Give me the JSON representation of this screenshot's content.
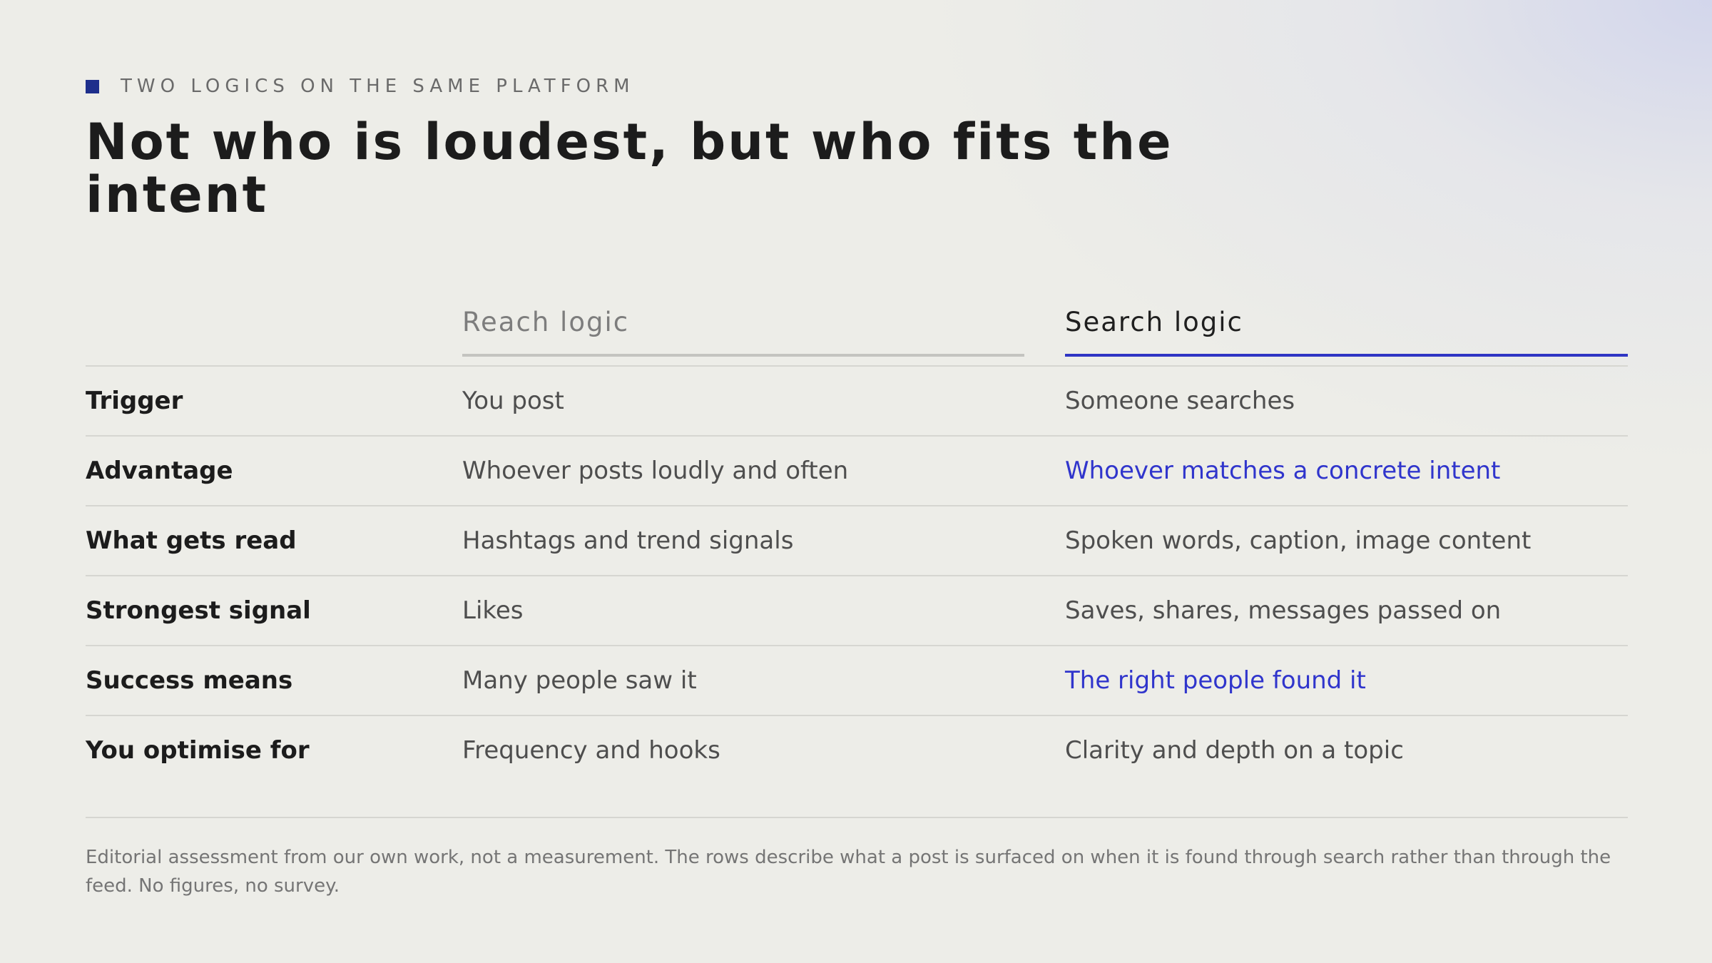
{
  "eyebrow": {
    "label": "TWO LOGICS ON THE SAME PLATFORM"
  },
  "title": "Not who is loudest, but who fits the intent",
  "columns": {
    "reach": "Reach logic",
    "search": "Search logic"
  },
  "rows": [
    {
      "label": "Trigger",
      "reach": "You post",
      "search": "Someone searches",
      "search_highlight": false
    },
    {
      "label": "Advantage",
      "reach": "Whoever posts loudly and often",
      "search": "Whoever matches a concrete intent",
      "search_highlight": true
    },
    {
      "label": "What gets read",
      "reach": "Hashtags and trend signals",
      "search": "Spoken words, caption, image content",
      "search_highlight": false
    },
    {
      "label": "Strongest signal",
      "reach": "Likes",
      "search": "Saves, shares, messages passed on",
      "search_highlight": false
    },
    {
      "label": "Success means",
      "reach": "Many people saw it",
      "search": "The right people found it",
      "search_highlight": true
    },
    {
      "label": "You optimise for",
      "reach": "Frequency and hooks",
      "search": "Clarity and depth on a topic",
      "search_highlight": false
    }
  ],
  "footnote": "Editorial assessment from our own work, not a measurement. The rows describe what a post is surfaced on when it is found through search rather than through the feed. No figures, no survey.",
  "colors": {
    "accent": "#3035cc",
    "marker": "#1e2f8c",
    "background": "#edede8"
  }
}
